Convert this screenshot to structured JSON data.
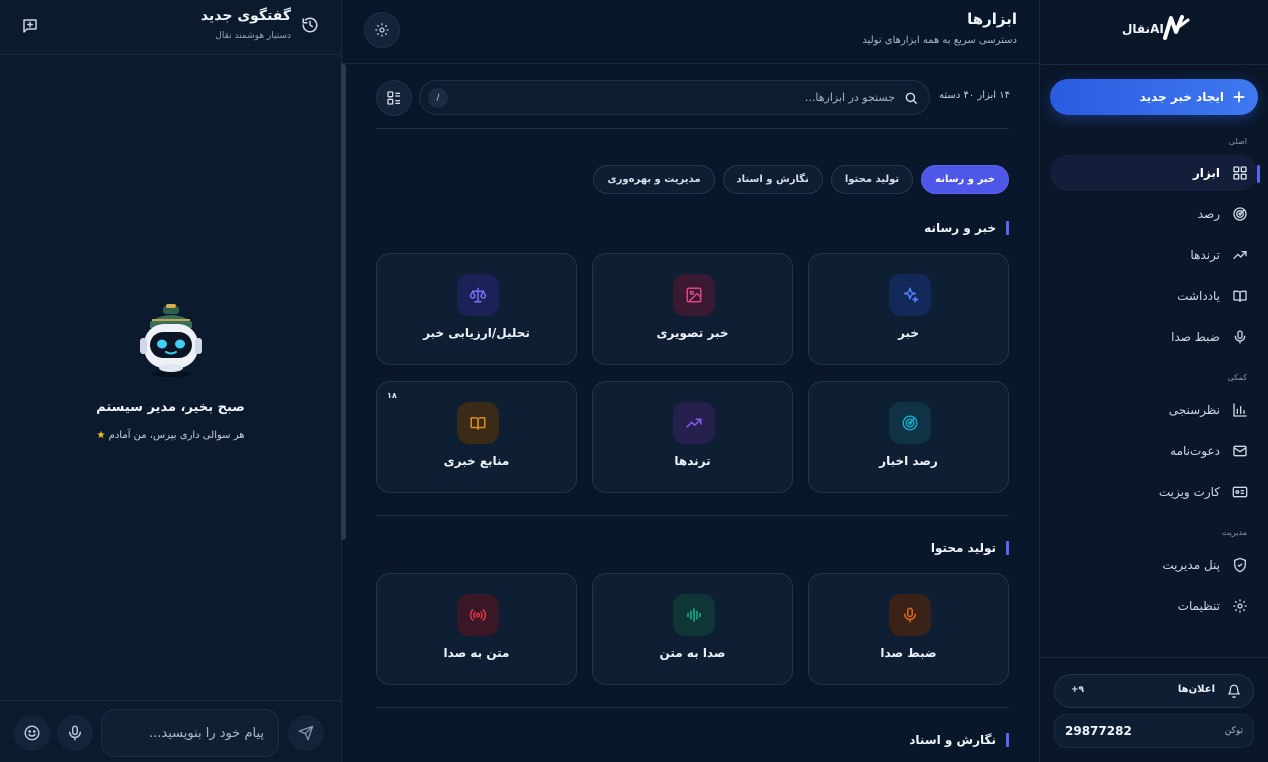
{
  "chat": {
    "title": "گفتگوی جدید",
    "subtitle": "دستیار هوشمند نقال",
    "greeting": "صبح بخیر، مدیر سیستم",
    "prompt": "هر سوالی داری بپرس، من آمادم",
    "input_placeholder": "پیام خود را بنویسید..."
  },
  "main": {
    "title": "ابزارها",
    "subtitle": "دسترسی سریع به همه ابزارهای تولید",
    "counts": "۱۴ ابزار ۴۰ دسته",
    "search_placeholder": "جستجو در ابزارها...",
    "search_shortcut": "/",
    "tabs": [
      {
        "label": "خبر و رسانه",
        "active": true
      },
      {
        "label": "تولید محتوا",
        "active": false
      },
      {
        "label": "نگارش و اسناد",
        "active": false
      },
      {
        "label": "مدیریت و بهره‌وری",
        "active": false
      }
    ],
    "sections": [
      {
        "title": "خبر و رسانه",
        "cards": [
          {
            "label": "خبر",
            "icon": "sparkles-icon",
            "color": "#3b6ff0"
          },
          {
            "label": "خبر تصویری",
            "icon": "image-icon",
            "color": "#e0448d"
          },
          {
            "label": "تحلیل/ارزیابی خبر",
            "icon": "scale-icon",
            "color": "#6a5cf0"
          },
          {
            "label": "رصد اخبار",
            "icon": "radar-icon",
            "color": "#19a7c9"
          },
          {
            "label": "ترندها",
            "icon": "trending-up-icon",
            "color": "#8b5cf0"
          },
          {
            "label": "منابع خبری",
            "icon": "book-icon",
            "color": "#e08a1e",
            "badge": "۱۸"
          }
        ]
      },
      {
        "title": "تولید محتوا",
        "cards": [
          {
            "label": "ضبط صدا",
            "icon": "microphone-icon",
            "color": "#e0661e"
          },
          {
            "label": "صدا به متن",
            "icon": "audio-wave-icon",
            "color": "#16b39a"
          },
          {
            "label": "متن به صدا",
            "icon": "broadcast-icon",
            "color": "#e0344d"
          }
        ]
      },
      {
        "title": "نگارش و اسناد"
      }
    ]
  },
  "sidebar": {
    "brand": "نقالAI",
    "new_button": "ایجاد خبر جدید",
    "groups": [
      {
        "label": "اصلی",
        "items": [
          {
            "label": "ابزار",
            "icon": "grid-icon",
            "active": true
          },
          {
            "label": "رصد",
            "icon": "radar-icon"
          },
          {
            "label": "ترندها",
            "icon": "trending-up-icon"
          },
          {
            "label": "یادداشت",
            "icon": "book-open-icon"
          },
          {
            "label": "ضبط صدا",
            "icon": "microphone-icon"
          }
        ]
      },
      {
        "label": "کمکی",
        "items": [
          {
            "label": "نظرسنجی",
            "icon": "bar-chart-icon"
          },
          {
            "label": "دعوت‌نامه",
            "icon": "mail-icon"
          },
          {
            "label": "کارت ویزیت",
            "icon": "id-card-icon"
          }
        ]
      },
      {
        "label": "مدیریت",
        "items": [
          {
            "label": "پنل مدیریت",
            "icon": "shield-icon"
          },
          {
            "label": "تنظیمات",
            "icon": "gear-icon"
          }
        ]
      }
    ],
    "notifications_label": "اعلان‌ها",
    "notifications_count": "+۹",
    "token_label": "توکن",
    "token_value": "29877282"
  },
  "colors": {
    "accent": "#5b63f0",
    "primary_button": "#3168ea",
    "background": "#0a1628"
  }
}
